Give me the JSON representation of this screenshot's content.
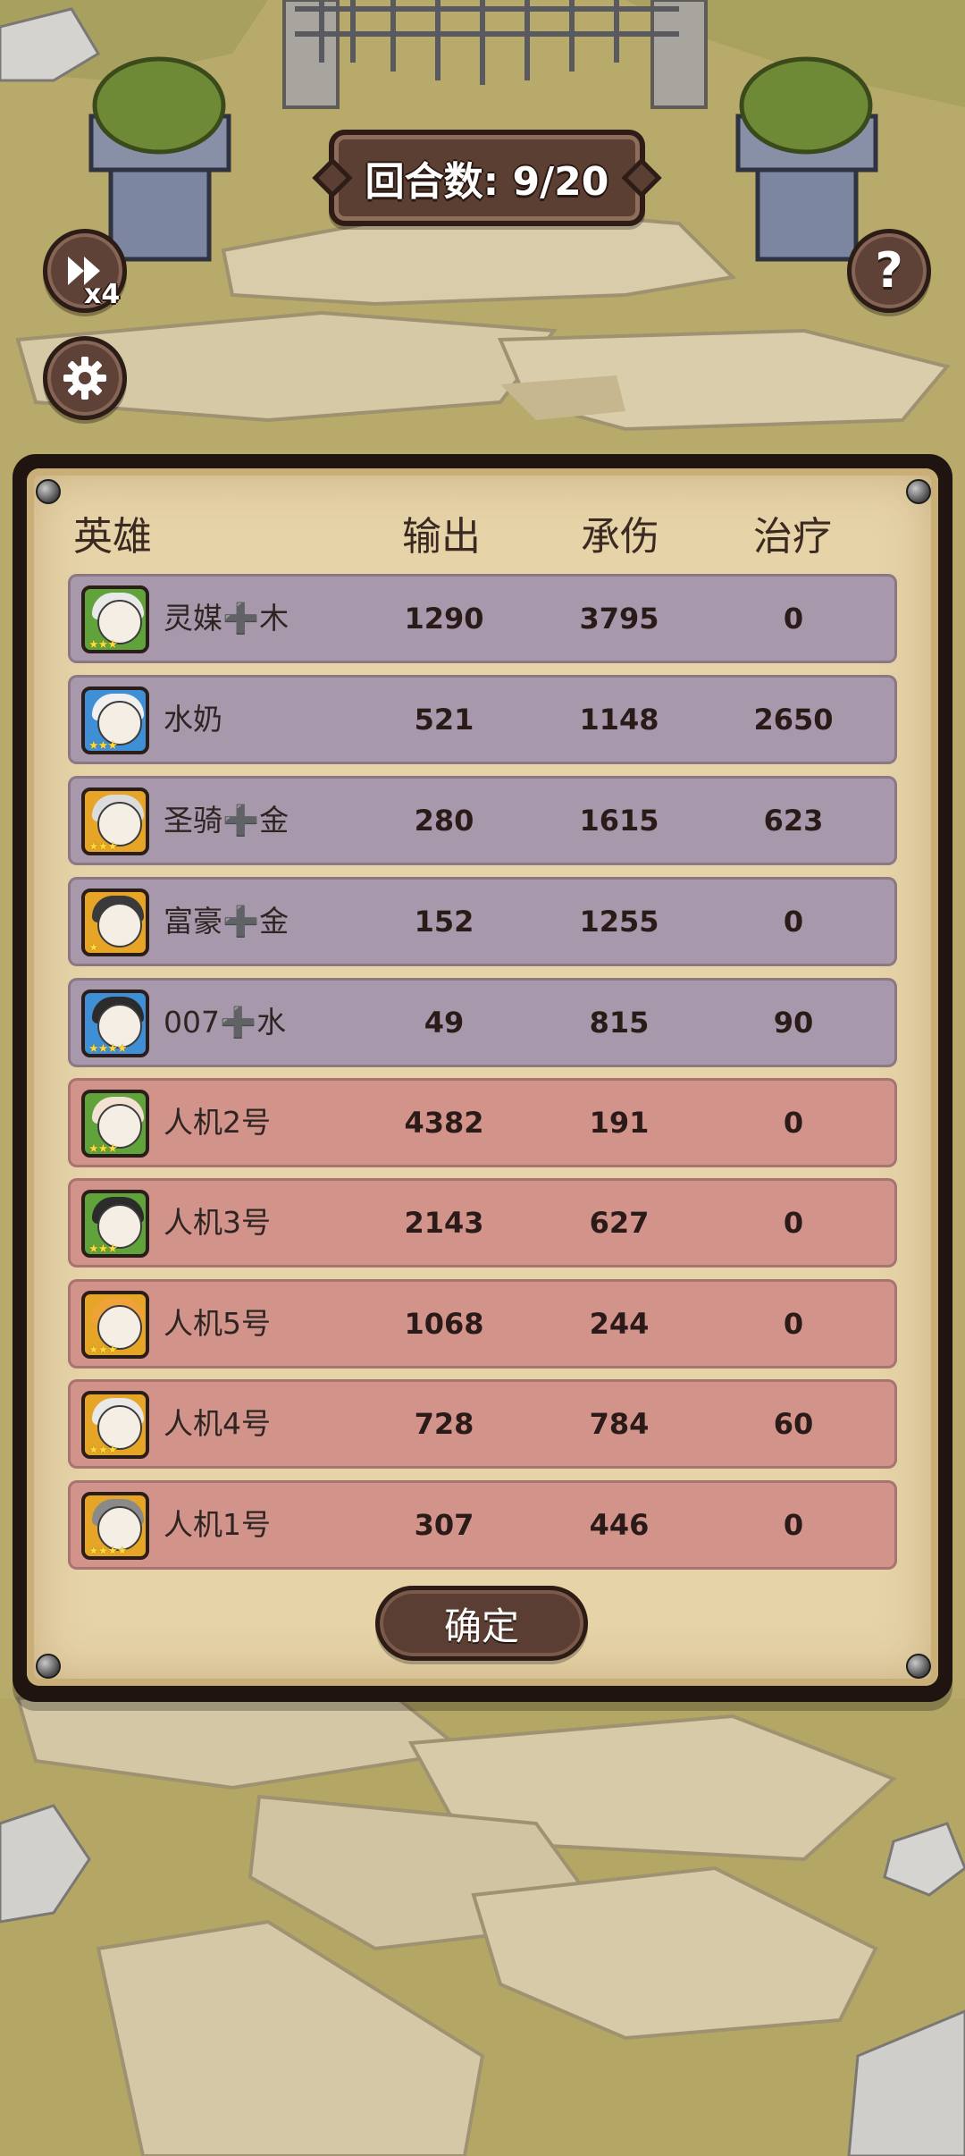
{
  "hud": {
    "round_label": "回合数: 9/20",
    "speed_label": "x4",
    "help_label": "?"
  },
  "panel": {
    "headers": {
      "hero": "英雄",
      "damage": "输出",
      "tank": "承伤",
      "heal": "治疗"
    },
    "allies": [
      {
        "name": "灵媒➕木",
        "damage": "1290",
        "tank": "3795",
        "heal": "0"
      },
      {
        "name": "水奶",
        "damage": "521",
        "tank": "1148",
        "heal": "2650"
      },
      {
        "name": "圣骑➕金",
        "damage": "280",
        "tank": "1615",
        "heal": "623"
      },
      {
        "name": "富豪➕金",
        "damage": "152",
        "tank": "1255",
        "heal": "0"
      },
      {
        "name": "007➕水",
        "damage": "49",
        "tank": "815",
        "heal": "90"
      }
    ],
    "enemies": [
      {
        "name": "人机2号",
        "damage": "4382",
        "tank": "191",
        "heal": "0"
      },
      {
        "name": "人机3号",
        "damage": "2143",
        "tank": "627",
        "heal": "0"
      },
      {
        "name": "人机5号",
        "damage": "1068",
        "tank": "244",
        "heal": "0"
      },
      {
        "name": "人机4号",
        "damage": "728",
        "tank": "784",
        "heal": "60"
      },
      {
        "name": "人机1号",
        "damage": "307",
        "tank": "446",
        "heal": "0"
      }
    ],
    "confirm_label": "确定"
  },
  "colors": {
    "ally_row": "#a799ab",
    "enemy_row": "#d2938a",
    "parchment": "#e6d3a8",
    "button_brown": "#5a3e33"
  },
  "icons": [
    "fast-forward-icon",
    "gear-icon",
    "help-icon"
  ]
}
